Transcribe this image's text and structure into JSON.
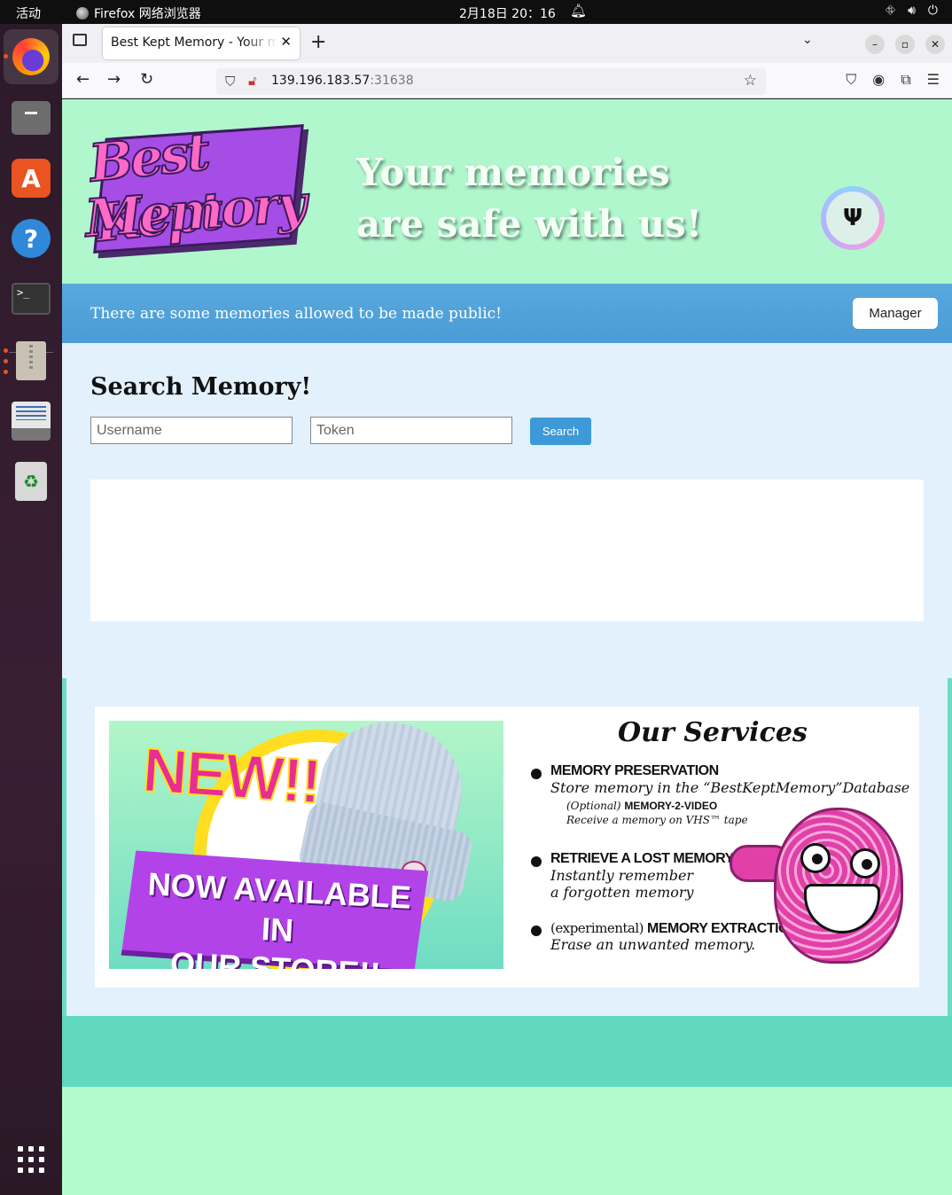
{
  "system": {
    "activities": "活动",
    "app_name": "Firefox 网络浏览器",
    "clock": "2月18日  20：16"
  },
  "browser": {
    "tab_title": "Best Kept Memory - Your memories are safe with us!",
    "url_host": "139.196.183.57",
    "url_port": ":31638"
  },
  "hero": {
    "logo_line1": "Best Kept",
    "logo_line2": "Memory",
    "tagline_line1": "Your memories",
    "tagline_line2": "are safe with us!"
  },
  "notice": {
    "message": "There are some memories allowed to be made public!",
    "manager_label": "Manager"
  },
  "search": {
    "heading": "Search Memory!",
    "username_placeholder": "Username",
    "token_placeholder": "Token",
    "button_label": "Search"
  },
  "promo": {
    "new_text": "NEW!!",
    "ribbon_line1": "NOW AVAILABLE IN",
    "ribbon_line2": "OUR STORE!!"
  },
  "services": {
    "title": "Our Services",
    "items": [
      {
        "name": "MEMORY PRESERVATION",
        "desc": "Store memory in the “BestKeptMemory”Database",
        "sub_optional": "(Optional)",
        "sub_name": "MEMORY-2-VIDEO",
        "sub_desc": "Receive a memory on VHS™ tape"
      },
      {
        "name": "RETRIEVE A LOST MEMORY",
        "desc_line1": "Instantly remember",
        "desc_line2": "a forgotten memory"
      },
      {
        "prefix": "(experimental)",
        "name": "MEMORY EXTRACTION",
        "desc": "Erase an unwanted memory."
      }
    ]
  }
}
